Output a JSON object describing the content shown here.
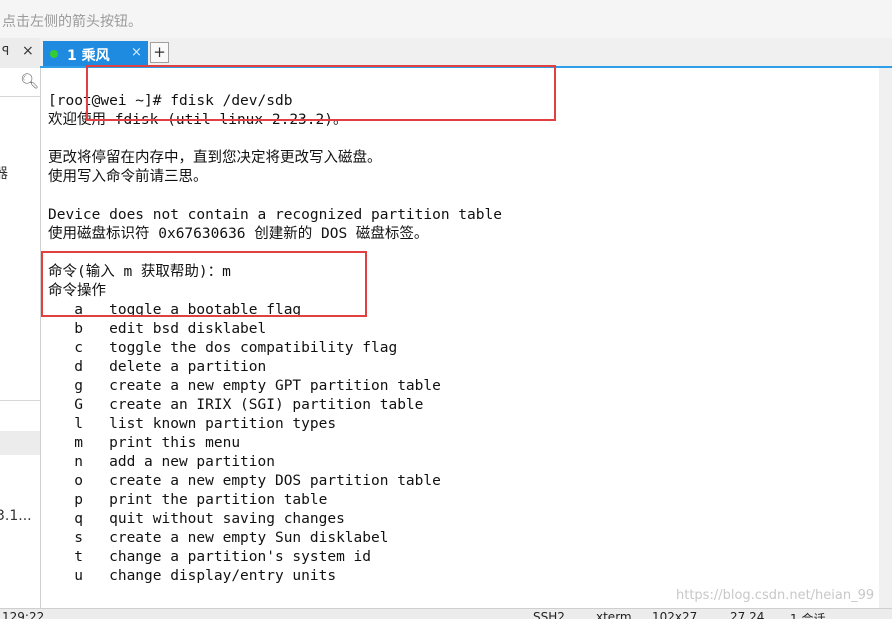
{
  "toolbar": {
    "hint": "点击左侧的箭头按钮。"
  },
  "left_panel": {
    "pin_glyph": "ꟼ",
    "close_glyph": "×",
    "search_icon": "search-icon",
    "fragment_1": "器",
    "fragment_2": "3.1..."
  },
  "tabs": [
    {
      "label": "1 乘风",
      "close": "×",
      "status_color": "#33cc33"
    }
  ],
  "add_tab_label": "+",
  "terminal": {
    "lines": [
      "[root@wei ~]# fdisk /dev/sdb",
      "欢迎使用 fdisk (util-linux 2.23.2)。",
      "",
      "更改将停留在内存中，直到您决定将更改写入磁盘。",
      "使用写入命令前请三思。",
      "",
      "Device does not contain a recognized partition table",
      "使用磁盘标识符 0x67630636 创建新的 DOS 磁盘标签。",
      "",
      "命令(输入 m 获取帮助)：m",
      "命令操作",
      "   a   toggle a bootable flag",
      "   b   edit bsd disklabel",
      "   c   toggle the dos compatibility flag",
      "   d   delete a partition",
      "   g   create a new empty GPT partition table",
      "   G   create an IRIX (SGI) partition table",
      "   l   list known partition types",
      "   m   print this menu",
      "   n   add a new partition",
      "   o   create a new empty DOS partition table",
      "   p   print the partition table",
      "   q   quit without saving changes",
      "   s   create a new empty Sun disklabel",
      "   t   change a partition's system id",
      "   u   change display/entry units"
    ]
  },
  "annotation_color": "#e04040",
  "status_bar": {
    "time": "129:22",
    "protocol": "SSH2",
    "term": "xterm",
    "size": "102x27",
    "cursor": "27,24",
    "sessions": "1 会话"
  },
  "watermark": "https://blog.csdn.net/heian_99"
}
